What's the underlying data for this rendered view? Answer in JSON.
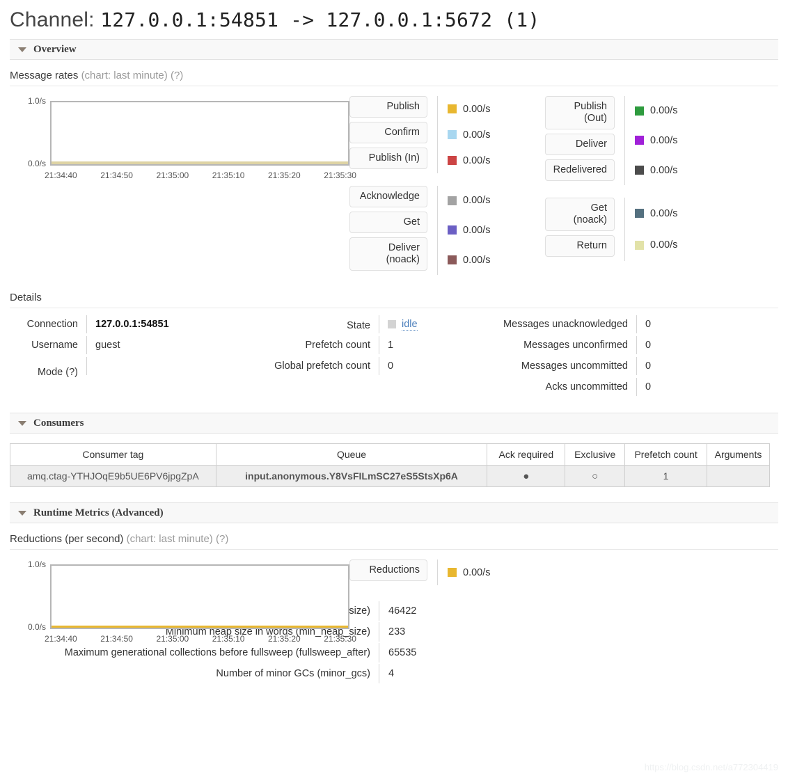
{
  "page": {
    "title_prefix": "Channel:",
    "title_value": "127.0.0.1:54851 -> 127.0.0.1:5672 (1)"
  },
  "sections": {
    "overview": "Overview",
    "consumers": "Consumers",
    "runtime": "Runtime Metrics (Advanced)"
  },
  "message_rates": {
    "label": "Message rates",
    "chart_note": "(chart: last minute)",
    "help": "(?)"
  },
  "reductions": {
    "label": "Reductions (per second)",
    "chart_note": "(chart: last minute)",
    "help": "(?)",
    "button": "Reductions",
    "value": "0.00/s",
    "color": "#e8b730"
  },
  "chart_data": [
    {
      "type": "line",
      "title": "Message rates",
      "subtitle": "(chart: last minute)",
      "xlabel": "",
      "ylabel": "",
      "ylim": [
        0,
        1
      ],
      "ytick_labels": [
        "1.0/s",
        "0.0/s"
      ],
      "x": [
        "21:34:40",
        "21:34:50",
        "21:35:00",
        "21:35:10",
        "21:35:20",
        "21:35:30"
      ],
      "grid": false,
      "legend_position": "right",
      "series": [
        {
          "name": "Publish",
          "values": [
            0,
            0,
            0,
            0,
            0,
            0
          ],
          "color": "#e8b730",
          "rate": "0.00/s"
        },
        {
          "name": "Confirm",
          "values": [
            0,
            0,
            0,
            0,
            0,
            0
          ],
          "color": "#a8d7f0",
          "rate": "0.00/s"
        },
        {
          "name": "Publish (In)",
          "values": [
            0,
            0,
            0,
            0,
            0,
            0
          ],
          "color": "#cc4444",
          "rate": "0.00/s"
        },
        {
          "name": "Publish (Out)",
          "values": [
            0,
            0,
            0,
            0,
            0,
            0
          ],
          "color": "#2e9b3e",
          "rate": "0.00/s"
        },
        {
          "name": "Deliver",
          "values": [
            0,
            0,
            0,
            0,
            0,
            0
          ],
          "color": "#a020d8",
          "rate": "0.00/s"
        },
        {
          "name": "Redelivered",
          "values": [
            0,
            0,
            0,
            0,
            0,
            0
          ],
          "color": "#4c4c4c",
          "rate": "0.00/s"
        },
        {
          "name": "Acknowledge",
          "values": [
            0,
            0,
            0,
            0,
            0,
            0
          ],
          "color": "#a3a3a3",
          "rate": "0.00/s"
        },
        {
          "name": "Get",
          "values": [
            0,
            0,
            0,
            0,
            0,
            0
          ],
          "color": "#6b5fc4",
          "rate": "0.00/s"
        },
        {
          "name": "Deliver (noack)",
          "values": [
            0,
            0,
            0,
            0,
            0,
            0
          ],
          "color": "#8b5a5a",
          "rate": "0.00/s"
        },
        {
          "name": "Get (noack)",
          "values": [
            0,
            0,
            0,
            0,
            0,
            0
          ],
          "color": "#54707f",
          "rate": "0.00/s"
        },
        {
          "name": "Return",
          "values": [
            0,
            0,
            0,
            0,
            0,
            0
          ],
          "color": "#e2e2a8",
          "rate": "0.00/s"
        }
      ]
    },
    {
      "type": "line",
      "title": "Reductions (per second)",
      "subtitle": "(chart: last minute)",
      "xlabel": "",
      "ylabel": "",
      "ylim": [
        0,
        1
      ],
      "ytick_labels": [
        "1.0/s",
        "0.0/s"
      ],
      "x": [
        "21:34:40",
        "21:34:50",
        "21:35:00",
        "21:35:10",
        "21:35:20",
        "21:35:30"
      ],
      "grid": false,
      "legend_position": "right",
      "series": [
        {
          "name": "Reductions",
          "values": [
            0,
            0,
            0,
            0,
            0,
            0
          ],
          "color": "#e8b730",
          "rate": "0.00/s"
        }
      ]
    }
  ],
  "chart_axis": {
    "y_top": "1.0/s",
    "y_bottom": "0.0/s",
    "x_ticks": [
      "21:34:40",
      "21:34:50",
      "21:35:00",
      "21:35:10",
      "21:35:20",
      "21:35:30"
    ],
    "baseline_color_top": "#ded3a4",
    "baseline_color_bottom": "#e8b730"
  },
  "legend": {
    "col1_group1": [
      {
        "label": "Publish",
        "value": "0.00/s",
        "color": "#e8b730"
      },
      {
        "label": "Confirm",
        "value": "0.00/s",
        "color": "#a8d7f0"
      },
      {
        "label": "Publish (In)",
        "value": "0.00/s",
        "color": "#cc4444"
      }
    ],
    "col1_group2": [
      {
        "label": "Acknowledge",
        "value": "0.00/s",
        "color": "#a3a3a3"
      },
      {
        "label": "Get",
        "value": "0.00/s",
        "color": "#6b5fc4"
      },
      {
        "label": "Deliver\n(noack)",
        "value": "0.00/s",
        "color": "#8b5a5a"
      }
    ],
    "col2_group1": [
      {
        "label": "Publish\n(Out)",
        "value": "0.00/s",
        "color": "#2e9b3e"
      },
      {
        "label": "Deliver",
        "value": "0.00/s",
        "color": "#a020d8"
      },
      {
        "label": "Redelivered",
        "value": "0.00/s",
        "color": "#4c4c4c"
      }
    ],
    "col2_group2": [
      {
        "label": "Get\n(noack)",
        "value": "0.00/s",
        "color": "#54707f"
      },
      {
        "label": "Return",
        "value": "0.00/s",
        "color": "#e2e2a8"
      }
    ]
  },
  "details": {
    "heading": "Details",
    "col1": [
      {
        "label": "Connection",
        "value": "127.0.0.1:54851",
        "bold": true
      },
      {
        "label": "Username",
        "value": "guest",
        "bold": false
      },
      {
        "label": "Mode (?)",
        "value": "",
        "bold": false
      }
    ],
    "col2": [
      {
        "label": "State",
        "value": "idle",
        "is_state": true
      },
      {
        "label": "Prefetch count",
        "value": "1",
        "is_state": false
      },
      {
        "label": "Global prefetch count",
        "value": "0",
        "is_state": false
      }
    ],
    "col3": [
      {
        "label": "Messages unacknowledged",
        "value": "0"
      },
      {
        "label": "Messages unconfirmed",
        "value": "0"
      },
      {
        "label": "Messages uncommitted",
        "value": "0"
      },
      {
        "label": "Acks uncommitted",
        "value": "0"
      }
    ]
  },
  "consumers_table": {
    "columns": [
      "Consumer tag",
      "Queue",
      "Ack required",
      "Exclusive",
      "Prefetch count",
      "Arguments"
    ],
    "rows": [
      {
        "consumer_tag": "amq.ctag-YTHJOqE9b5UE6PV6jpgZpA",
        "queue": "input.anonymous.Y8VsFILmSC27eS5StsXp6A",
        "ack_required": "●",
        "exclusive": "○",
        "prefetch_count": "1",
        "arguments": ""
      }
    ]
  },
  "runtime_metrics": [
    {
      "label": "Minimum binary virtual heap size in words (min_bin_vheap_size)",
      "value": "46422"
    },
    {
      "label": "Minimum heap size in words (min_heap_size)",
      "value": "233"
    },
    {
      "label": "Maximum generational collections before fullsweep (fullsweep_after)",
      "value": "65535"
    },
    {
      "label": "Number of minor GCs (minor_gcs)",
      "value": "4"
    }
  ],
  "watermark": "https://blog.csdn.net/a772304419"
}
